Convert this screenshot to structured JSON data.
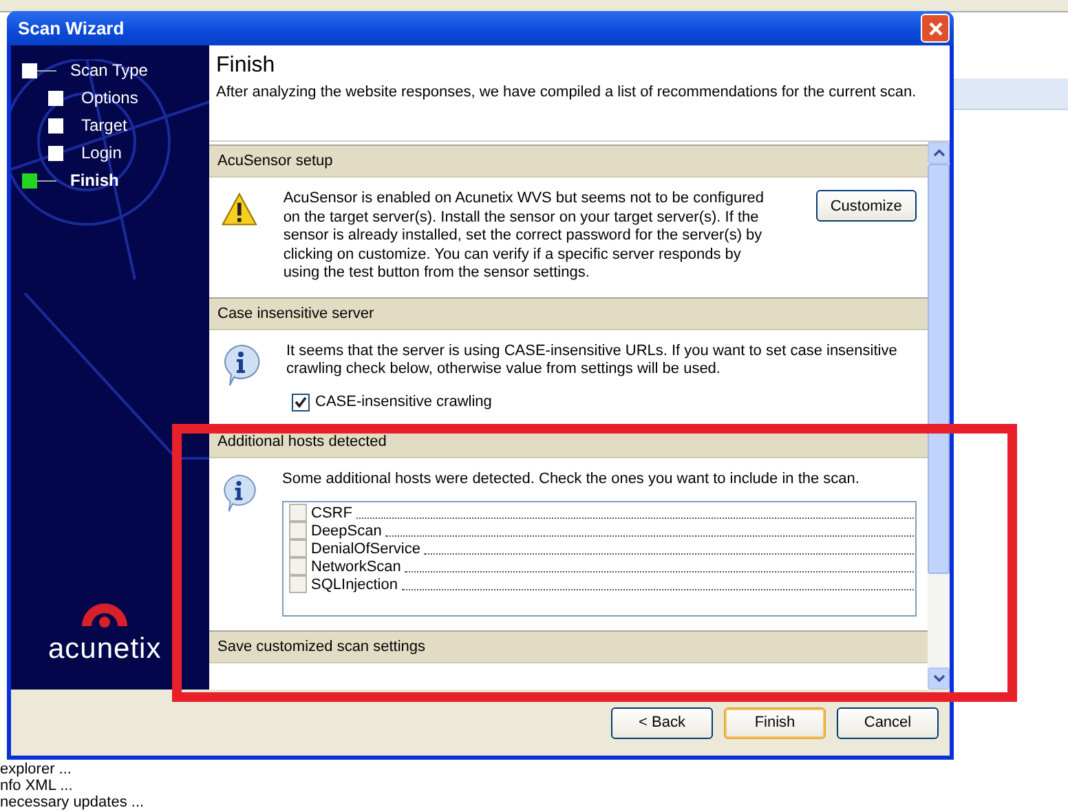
{
  "background": {
    "lines": [
      "explorer ...",
      "nfo XML ...",
      "necessary updates ..."
    ]
  },
  "window": {
    "title": "Scan Wizard"
  },
  "steps": [
    {
      "label": "Scan Type",
      "selected": false,
      "children": [
        {
          "label": "Options",
          "selected": false
        },
        {
          "label": "Target",
          "selected": false
        },
        {
          "label": "Login",
          "selected": false
        }
      ]
    },
    {
      "label": "Finish",
      "selected": true
    }
  ],
  "logo": {
    "text": "acunetix"
  },
  "page": {
    "title": "Finish",
    "description": "After analyzing the website responses, we have compiled a list of recommendations for the current scan."
  },
  "sections": [
    {
      "kind": "warning",
      "title": "AcuSensor setup",
      "text": "AcuSensor is enabled on Acunetix WVS but seems not to be configured on the target server(s). Install the sensor on your target server(s). If the sensor is already installed, set the correct password for the server(s) by clicking on customize. You can verify if a specific server responds by using the test button from the sensor settings.",
      "button": "Customize"
    },
    {
      "kind": "info",
      "title": "Case insensitive server",
      "text": "It seems that the server is using CASE-insensitive URLs. If you want to set case insensitive crawling check below, otherwise value from settings will be used.",
      "checkbox": {
        "label": "CASE-insensitive crawling",
        "checked": true
      }
    },
    {
      "kind": "hosts",
      "title": "Additional hosts detected",
      "text": "Some additional hosts were detected. Check the ones you want to include in the scan.",
      "hosts": [
        {
          "label": "CSRF",
          "checked": false
        },
        {
          "label": "DeepScan",
          "checked": false
        },
        {
          "label": "DenialOfService",
          "checked": false
        },
        {
          "label": "NetworkScan",
          "checked": false
        },
        {
          "label": "SQLInjection",
          "checked": false
        }
      ]
    },
    {
      "kind": "header",
      "title": "Save customized scan settings"
    }
  ],
  "buttons": [
    {
      "label": "< Back",
      "default": false
    },
    {
      "label": "Finish",
      "default": true
    },
    {
      "label": "Cancel",
      "default": false
    }
  ]
}
